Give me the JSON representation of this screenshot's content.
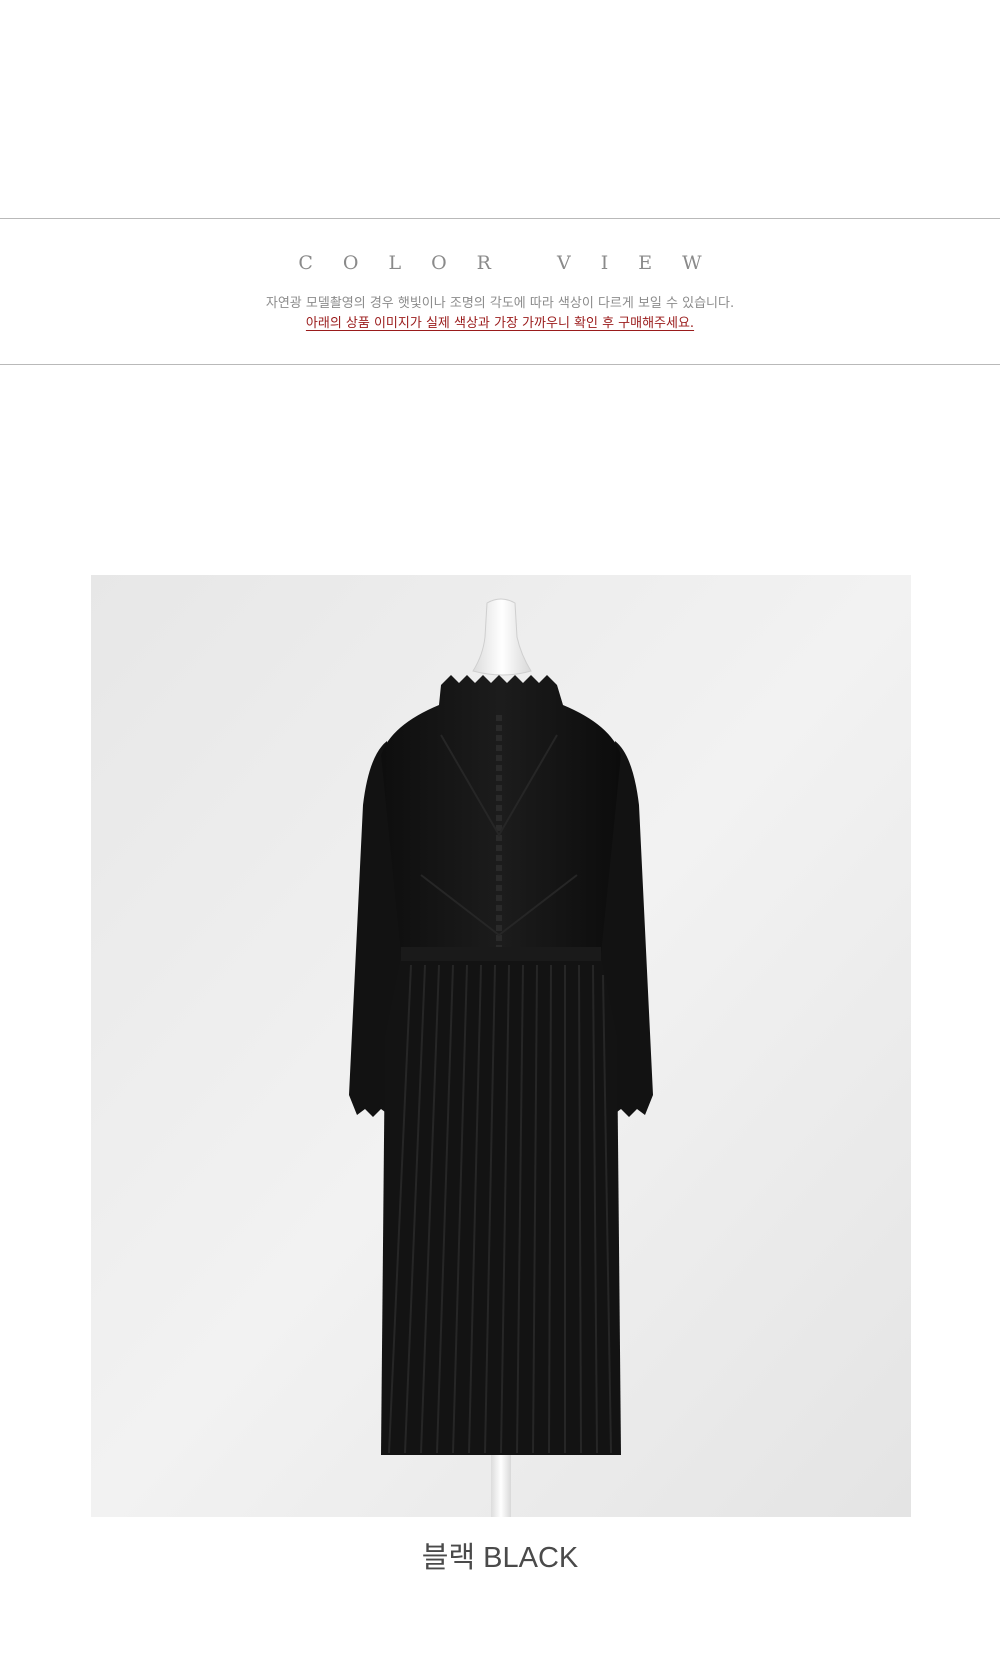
{
  "color_view": {
    "title": "COLOR VIEW",
    "notice_gray": "자연광 모델촬영의 경우 햇빛이나 조명의 각도에 따라 색상이 다르게 보일 수 있습니다.",
    "notice_red": "아래의 상품 이미지가 실제 색상과 가장 가까우니 확인 후 구매해주세요."
  },
  "product": {
    "color_caption": "블랙 BLACK",
    "photo_subject": "black-pleated-knit-dress-on-mannequin"
  },
  "colors": {
    "divider": "#b9b9b9",
    "title_gray": "#8a8a8a",
    "notice_red": "#9a1b1b",
    "dress": "#141414",
    "background": "#efefef"
  }
}
